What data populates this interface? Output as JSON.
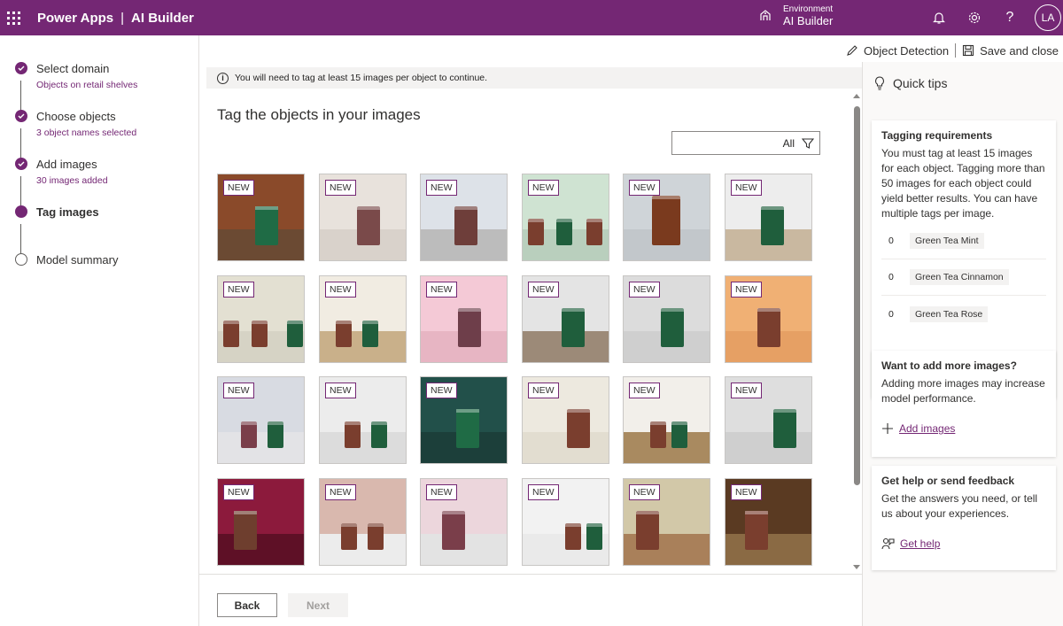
{
  "topbar": {
    "app_name": "Power Apps",
    "separator": "|",
    "product": "AI Builder",
    "environment_label": "Environment",
    "environment_value": "AI Builder",
    "avatar_initials": "LA",
    "help_glyph": "?"
  },
  "steps": [
    {
      "title": "Select domain",
      "sub": "Objects on retail shelves",
      "state": "done"
    },
    {
      "title": "Choose objects",
      "sub": "3 object names selected",
      "state": "done"
    },
    {
      "title": "Add images",
      "sub": "30 images added",
      "state": "done"
    },
    {
      "title": "Tag images",
      "sub": "",
      "state": "current"
    },
    {
      "title": "Model summary",
      "sub": "",
      "state": "pending"
    }
  ],
  "commands": {
    "object_detection": "Object Detection",
    "save_close": "Save and close"
  },
  "main": {
    "info_icon": "i",
    "info_message": "You will need to tag at least 15 images per object to continue.",
    "heading": "Tag the objects in your images",
    "filter_value": "All",
    "badge_label": "NEW",
    "back_label": "Back",
    "next_label": "Next"
  },
  "tiles": [
    {
      "bg": "#8a4a2a",
      "shelf": "#6b4a33",
      "cans": [
        {
          "x": 42,
          "c": "#1f6b45",
          "s": "big"
        }
      ]
    },
    {
      "bg": "#e8e2dc",
      "shelf": "#d9d2cb",
      "cans": [
        {
          "x": 42,
          "c": "#7a4a4a",
          "s": "big"
        }
      ]
    },
    {
      "bg": "#dde2e8",
      "shelf": "#bcbcbc",
      "cans": [
        {
          "x": 38,
          "c": "#6e3e3a",
          "s": "big"
        }
      ]
    },
    {
      "bg": "#cfe3d2",
      "shelf": "#b9cfbd",
      "cans": [
        {
          "x": 6,
          "c": "#7a3e2e",
          "s": ""
        },
        {
          "x": 38,
          "c": "#1f5e3c",
          "s": ""
        },
        {
          "x": 72,
          "c": "#7a3e2e",
          "s": ""
        }
      ]
    },
    {
      "bg": "#cfd4d8",
      "shelf": "#c2c7cb",
      "cans": [
        {
          "x": 32,
          "c": "#7a3a1e",
          "s": "xl"
        }
      ]
    },
    {
      "bg": "#ededed",
      "shelf": "#c9b8a0",
      "cans": [
        {
          "x": 40,
          "c": "#1f5e3c",
          "s": "big"
        }
      ]
    },
    {
      "bg": "#e3e0d2",
      "shelf": "#d6d3c5",
      "cans": [
        {
          "x": 6,
          "c": "#7a3e2e",
          "s": ""
        },
        {
          "x": 38,
          "c": "#7a3e2e",
          "s": ""
        },
        {
          "x": 78,
          "c": "#1f5e3c",
          "s": ""
        }
      ]
    },
    {
      "bg": "#f1ece2",
      "shelf": "#c9b08a",
      "cans": [
        {
          "x": 18,
          "c": "#7a3e2e",
          "s": ""
        },
        {
          "x": 48,
          "c": "#1f5e3c",
          "s": ""
        }
      ]
    },
    {
      "bg": "#f4c9d6",
      "shelf": "#e7b5c3",
      "cans": [
        {
          "x": 42,
          "c": "#6e3e4a",
          "s": "big"
        }
      ]
    },
    {
      "bg": "#e4e4e4",
      "shelf": "#9c8a78",
      "cans": [
        {
          "x": 44,
          "c": "#1f5e3c",
          "s": "big"
        }
      ]
    },
    {
      "bg": "#dcdcdc",
      "shelf": "#cfcfcf",
      "cans": [
        {
          "x": 42,
          "c": "#1f5e3c",
          "s": "big"
        }
      ]
    },
    {
      "bg": "#f0b074",
      "shelf": "#e6a064",
      "cans": [
        {
          "x": 36,
          "c": "#7a3e2e",
          "s": "big"
        }
      ]
    },
    {
      "bg": "#d8dbe2",
      "shelf": "#e3e3e6",
      "cans": [
        {
          "x": 26,
          "c": "#7a3e4a",
          "s": ""
        },
        {
          "x": 56,
          "c": "#1f5e3c",
          "s": ""
        }
      ]
    },
    {
      "bg": "#ececec",
      "shelf": "#dcdcdc",
      "cans": [
        {
          "x": 28,
          "c": "#7a3e2e",
          "s": ""
        },
        {
          "x": 58,
          "c": "#1f5e3c",
          "s": ""
        }
      ]
    },
    {
      "bg": "#22504a",
      "shelf": "#1c3f3a",
      "cans": [
        {
          "x": 40,
          "c": "#1f6b45",
          "s": "big"
        }
      ]
    },
    {
      "bg": "#ede9df",
      "shelf": "#e2ddd0",
      "cans": [
        {
          "x": 50,
          "c": "#7a3e2e",
          "s": "big"
        }
      ]
    },
    {
      "bg": "#f2efea",
      "shelf": "#a98a60",
      "cans": [
        {
          "x": 30,
          "c": "#7a3e2e",
          "s": ""
        },
        {
          "x": 54,
          "c": "#1f5e3c",
          "s": ""
        }
      ]
    },
    {
      "bg": "#dedede",
      "shelf": "#cfcfcf",
      "cans": [
        {
          "x": 54,
          "c": "#1f5e3c",
          "s": "big"
        }
      ]
    },
    {
      "bg": "#8c1a3c",
      "shelf": "#5e1026",
      "cans": [
        {
          "x": 18,
          "c": "#6e3e2e",
          "s": "big"
        }
      ]
    },
    {
      "bg": "#d9b8ae",
      "shelf": "#ececec",
      "cans": [
        {
          "x": 24,
          "c": "#7a3e2e",
          "s": ""
        },
        {
          "x": 54,
          "c": "#7a3e2e",
          "s": ""
        }
      ]
    },
    {
      "bg": "#ecd6dc",
      "shelf": "#e3e3e3",
      "cans": [
        {
          "x": 24,
          "c": "#7a3e4a",
          "s": "big"
        }
      ]
    },
    {
      "bg": "#f2f2f2",
      "shelf": "#eaeaea",
      "cans": [
        {
          "x": 48,
          "c": "#7a3e2e",
          "s": ""
        },
        {
          "x": 72,
          "c": "#1f5e3c",
          "s": ""
        }
      ]
    },
    {
      "bg": "#d2c8a8",
      "shelf": "#a9805a",
      "cans": [
        {
          "x": 14,
          "c": "#7a3e2e",
          "s": "big"
        }
      ]
    },
    {
      "bg": "#5a3a22",
      "shelf": "#8a6a44",
      "cans": [
        {
          "x": 22,
          "c": "#7a3e2e",
          "s": "big"
        }
      ]
    }
  ],
  "panel": {
    "title": "Quick tips",
    "tagging": {
      "heading": "Tagging requirements",
      "text": "You must tag at least 15 images for each object. Tagging more than 50 images for each object could yield better results. You can have multiple tags per image.",
      "tags": [
        {
          "count": "0",
          "name": "Green Tea Mint"
        },
        {
          "count": "0",
          "name": "Green Tea Cinnamon"
        },
        {
          "count": "0",
          "name": "Green Tea Rose"
        }
      ]
    },
    "more": {
      "heading": "Want to add more images?",
      "text": "Adding more images may increase model performance.",
      "link": "Add images"
    },
    "help": {
      "heading": "Get help or send feedback",
      "text": "Get the answers you need, or tell us about your experiences.",
      "link": "Get help"
    }
  }
}
